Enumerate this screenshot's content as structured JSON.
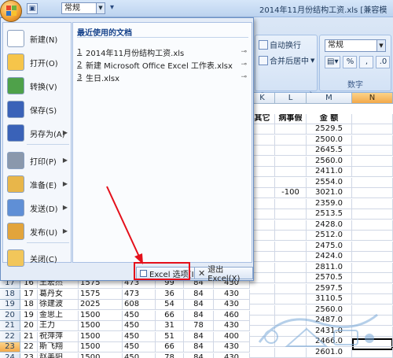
{
  "window": {
    "title": "2014年11月份结构工资.xls  [兼容模",
    "style_box": "常规"
  },
  "ribbon": {
    "wrap_text": "自动换行",
    "merge_center": "合并后居中",
    "alignment_group": "式",
    "number_format": "常规",
    "percent": "%",
    "comma": ",",
    "number_group": "数字"
  },
  "menu": {
    "items": [
      {
        "label": "新建(N)",
        "icon": "new-doc-icon",
        "color": "#ffffff"
      },
      {
        "label": "打开(O)",
        "icon": "folder-open-icon",
        "color": "#f6c54a"
      },
      {
        "label": "转换(V)",
        "icon": "convert-icon",
        "color": "#4fa14a"
      },
      {
        "label": "保存(S)",
        "icon": "save-icon",
        "color": "#3a62b8"
      },
      {
        "label": "另存为(A)",
        "icon": "save-as-icon",
        "color": "#3a62b8"
      },
      {
        "label": "打印(P)",
        "icon": "printer-icon",
        "color": "#8a98ac"
      },
      {
        "label": "准备(E)",
        "icon": "prepare-icon",
        "color": "#e8b64a"
      },
      {
        "label": "发送(D)",
        "icon": "send-icon",
        "color": "#5f8fd6"
      },
      {
        "label": "发布(U)",
        "icon": "publish-icon",
        "color": "#e2a43c"
      },
      {
        "label": "关闭(C)",
        "icon": "close-folder-icon",
        "color": "#f2c65a"
      }
    ],
    "recent_title": "最近使用的文档",
    "recent": [
      {
        "num": "1",
        "name": "2014年11月份结构工资.xls"
      },
      {
        "num": "2",
        "name": "新建 Microsoft Office Excel 工作表.xlsx"
      },
      {
        "num": "3",
        "name": "生日.xlsx"
      }
    ],
    "options_button": "Excel 选项(I)",
    "exit_button": "退出 Excel(X)"
  },
  "grid": {
    "columns": [
      "K",
      "L",
      "M",
      "N"
    ],
    "header_row": {
      "K": "其它",
      "L": "病事假",
      "M": "金  额"
    },
    "amounts": [
      "2529.5",
      "2500.0",
      "2645.5",
      "2560.0",
      "2411.0",
      "2554.0",
      "3021.0",
      "2359.0",
      "2513.5",
      "2428.0",
      "2512.0",
      "2475.0",
      "2424.0",
      "2811.0",
      "2570.5",
      "2597.5",
      "3110.5",
      "2560.0",
      "2487.0",
      "2431.0",
      "2466.0",
      "2601.0"
    ],
    "sick_value": "-100",
    "rows": [
      {
        "row": "17",
        "idx": "16",
        "name": "王宏杰",
        "b": "1575",
        "c": "473",
        "d": "99",
        "e": "84",
        "f": "430"
      },
      {
        "row": "18",
        "idx": "17",
        "name": "葛丹女",
        "b": "1575",
        "c": "473",
        "d": "36",
        "e": "84",
        "f": "430"
      },
      {
        "row": "19",
        "idx": "18",
        "name": "徐建波",
        "b": "2025",
        "c": "608",
        "d": "54",
        "e": "84",
        "f": "430"
      },
      {
        "row": "20",
        "idx": "19",
        "name": "金思上",
        "b": "1500",
        "c": "450",
        "d": "66",
        "e": "84",
        "f": "460"
      },
      {
        "row": "21",
        "idx": "20",
        "name": "王力",
        "b": "1500",
        "c": "450",
        "d": "31",
        "e": "78",
        "f": "430"
      },
      {
        "row": "22",
        "idx": "21",
        "name": "祝萍萍",
        "b": "1500",
        "c": "450",
        "d": "51",
        "e": "84",
        "f": "400"
      },
      {
        "row": "23",
        "idx": "22",
        "name": "斯飞翔",
        "b": "1500",
        "c": "450",
        "d": "66",
        "e": "84",
        "f": "430"
      },
      {
        "row": "24",
        "idx": "23",
        "name": "赵美阳",
        "b": "1500",
        "c": "450",
        "d": "78",
        "e": "84",
        "f": "430"
      }
    ]
  }
}
